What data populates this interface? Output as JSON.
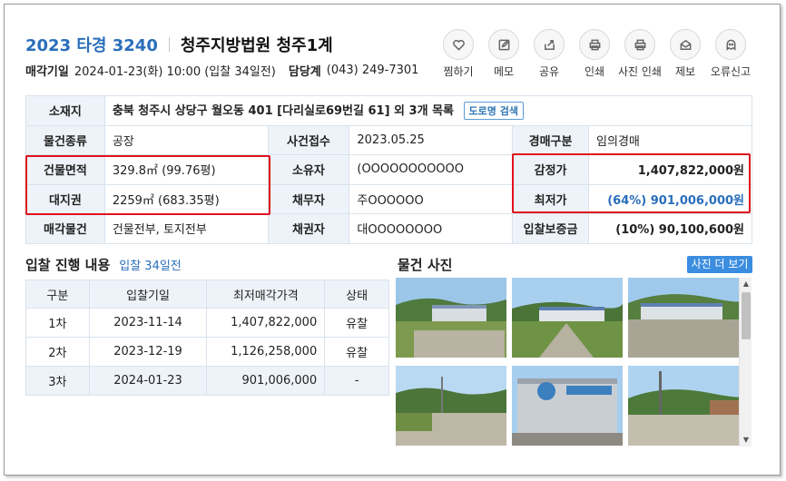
{
  "header": {
    "case_no": "2023 타경 3240",
    "court": "청주지방법원 청주1계",
    "sale_date_label": "매각기일",
    "sale_date": "2024-01-23(화) 10:00 (입찰 34일전)",
    "dept_label": "담당계",
    "dept_phone": "(043) 249-7301"
  },
  "actions": [
    {
      "label": "찜하기",
      "icon": "heart-icon"
    },
    {
      "label": "메모",
      "icon": "pencil-icon"
    },
    {
      "label": "공유",
      "icon": "share-icon"
    },
    {
      "label": "인쇄",
      "icon": "printer-icon"
    },
    {
      "label": "사진 인쇄",
      "icon": "printer-icon"
    },
    {
      "label": "제보",
      "icon": "mail-icon"
    },
    {
      "label": "오류신고",
      "icon": "ghost-icon"
    }
  ],
  "info": {
    "location_label": "소재지",
    "location": "충북 청주시 상당구 월오동 401 [다리실로69번길 61] 외 3개 목록",
    "road_btn": "도로명 검색",
    "type_label": "물건종류",
    "type": "공장",
    "received_label": "사건접수",
    "received": "2023.05.25",
    "auction_kind_label": "경매구분",
    "auction_kind": "임의경매",
    "bldg_area_label": "건물면적",
    "bldg_area": "329.8㎡ (99.76평)",
    "owner_label": "소유자",
    "owner": "(OOOOOOOOOOO",
    "appraisal_label": "감정가",
    "appraisal": "1,407,822,000원",
    "land_label": "대지권",
    "land": "2259㎡ (683.35평)",
    "debtor_label": "채무자",
    "debtor": "주OOOOOO",
    "min_price_label": "최저가",
    "min_price": "(64%) 901,006,000원",
    "sale_item_label": "매각물건",
    "sale_item": "건물전부, 토지전부",
    "creditor_label": "채권자",
    "creditor": "대OOOOOOOO",
    "deposit_label": "입찰보증금",
    "deposit": "(10%) 90,100,600원"
  },
  "bids": {
    "title": "입찰 진행 내용",
    "hint": "입찰 34일전",
    "headers": [
      "구분",
      "입찰기일",
      "최저매각가격",
      "상태"
    ],
    "rows": [
      [
        "1차",
        "2023-11-14",
        "1,407,822,000",
        "유찰"
      ],
      [
        "2차",
        "2023-12-19",
        "1,126,258,000",
        "유찰"
      ],
      [
        "3차",
        "2024-01-23",
        "901,006,000",
        "-"
      ]
    ]
  },
  "photos": {
    "title": "물건 사진",
    "more_btn": "사진 더 보기"
  },
  "colors": {
    "accent": "#2a6ebb",
    "header_cell": "#eef3f9",
    "highlight": "#e0121f",
    "button": "#3b8de0"
  }
}
